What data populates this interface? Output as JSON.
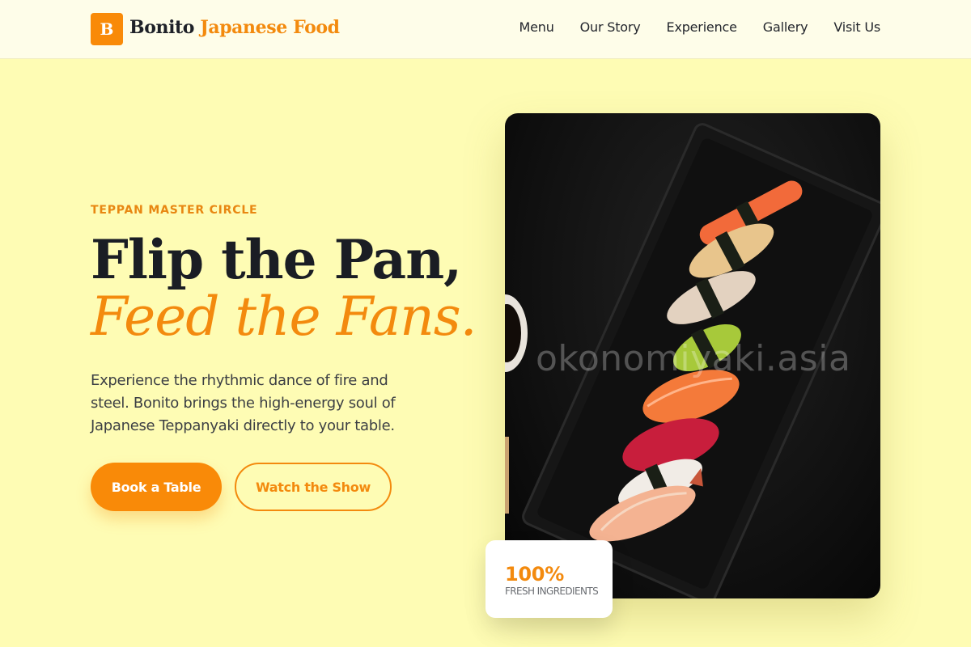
{
  "brand": {
    "logo_letter": "B",
    "name_part1": "Bonito",
    "name_part2": "Japanese Food",
    "accent_color": "#f98a08"
  },
  "nav": {
    "items": [
      "Menu",
      "Our Story",
      "Experience",
      "Gallery",
      "Visit Us"
    ]
  },
  "hero": {
    "eyebrow": "TEPPAN MASTER CIRCLE",
    "title_line1": "Flip the Pan,",
    "title_line2": "Feed the Fans.",
    "description": "Experience the rhythmic dance of fire and steel. Bonito brings the high-energy soul of Japanese Teppanyaki directly to your table.",
    "primary_button": "Book a Table",
    "secondary_button": "Watch the Show",
    "image_watermark": "okonomiyaki.asia",
    "stat": {
      "value": "100%",
      "label": "FRESH INGREDIENTS"
    }
  }
}
